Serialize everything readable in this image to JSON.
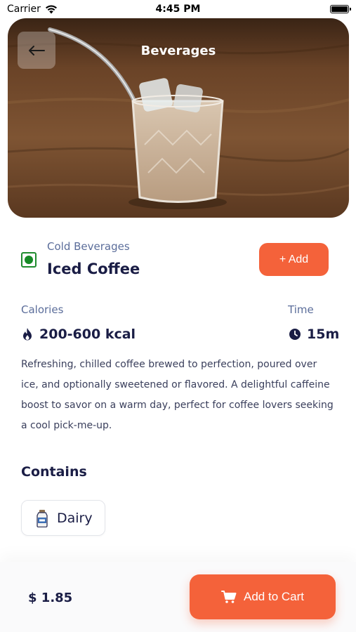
{
  "status_bar": {
    "carrier": "Carrier",
    "time": "4:45 PM"
  },
  "header": {
    "title": "Beverages",
    "back_icon": "arrow-left-icon"
  },
  "item": {
    "category": "Cold Beverages",
    "name": "Iced Coffee",
    "veg_indicator_color": "#168a26",
    "add_label": "+ Add"
  },
  "nutrition": {
    "calories_label": "Calories",
    "calories_value": "200-600 kcal",
    "calories_icon": "flame-icon",
    "time_label": "Time",
    "time_value": "15m",
    "time_icon": "clock-icon"
  },
  "description": "Refreshing, chilled coffee brewed to perfection, poured over ice, and optionally sweetened or flavored. A delightful caffeine boost to savor on a warm day, perfect for coffee lovers seeking a cool pick-me-up.",
  "contains": {
    "title": "Contains",
    "items": [
      {
        "label": "Dairy",
        "icon": "milk-bottle-icon"
      }
    ]
  },
  "footer": {
    "price": "$ 1.85",
    "cart_label": "Add to Cart",
    "cart_icon": "cart-icon"
  },
  "colors": {
    "accent": "#f4623a",
    "text_primary": "#1a1d45",
    "text_secondary": "#5b6d9a"
  }
}
